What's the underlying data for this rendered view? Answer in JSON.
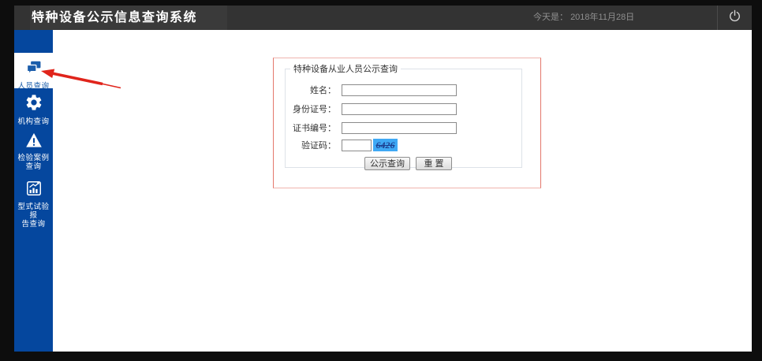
{
  "header": {
    "title": "特种设备公示信息查询系统",
    "date_label": "今天是：",
    "date_value": "2018年11月28日",
    "power_icon": "power-icon"
  },
  "sidebar": {
    "items": [
      {
        "name": "人员查询",
        "lines": [
          "人员查询"
        ],
        "icon": "comments-icon",
        "active": true
      },
      {
        "name": "机构查询",
        "lines": [
          "机构查询"
        ],
        "icon": "gear-icon",
        "active": false
      },
      {
        "name": "检验案例查询",
        "lines": [
          "检验案例",
          "查询"
        ],
        "icon": "warning-icon",
        "active": false
      },
      {
        "name": "型式试验报告查询",
        "lines": [
          "型式试验报",
          "告查询"
        ],
        "icon": "chart-icon",
        "active": false
      }
    ]
  },
  "form": {
    "legend": "特种设备从业人员公示查询",
    "fields": [
      {
        "label": "姓名：",
        "value": ""
      },
      {
        "label": "身份证号：",
        "value": ""
      },
      {
        "label": "证书编号：",
        "value": ""
      },
      {
        "label": "验证码：",
        "value": ""
      }
    ],
    "captcha": "6426",
    "buttons": {
      "query": "公示查询",
      "reset": "重 置"
    }
  },
  "annotation": {
    "shape": "red-arrow",
    "points_to": "人员查询"
  },
  "colors": {
    "page_margin": "#0d0d0d",
    "header_bg": "#333333",
    "sidebar_bg": "#05479e",
    "active_item": "#1a5dab",
    "captcha_bg": "#3fa9f5",
    "captcha_text": "#1d3e8f",
    "annotation_red": "#e0241b",
    "form_border": "#e4776c"
  }
}
